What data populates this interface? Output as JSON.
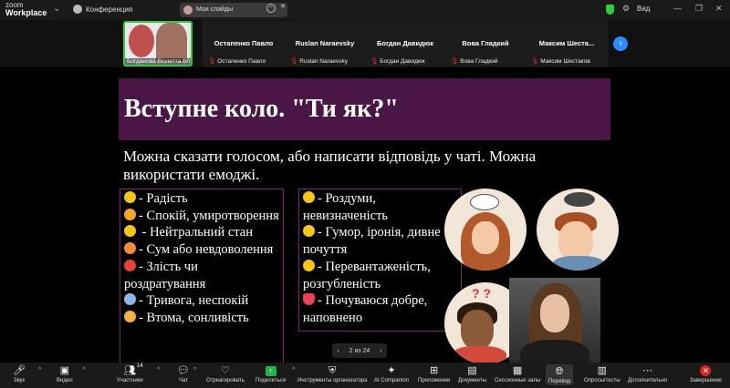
{
  "app": {
    "logo_line1": "zoom",
    "logo_line2": "Workplace"
  },
  "topbar": {
    "meeting_label": "Конференция",
    "share_title": "Мои слайды",
    "view_label": "Вид"
  },
  "participants": [
    {
      "display": "",
      "label": "Богданова Віолетта Віталі...",
      "muted": false,
      "active": true
    },
    {
      "display": "Остапенко Павло",
      "label": "Остапенко Павло",
      "muted": true
    },
    {
      "display": "Ruslan Naraevsky",
      "label": "Ruslan Naraevsky",
      "muted": true
    },
    {
      "display": "Богдан Давидюк",
      "label": "Богдан Давидюк",
      "muted": true
    },
    {
      "display": "Вова Гладкий",
      "label": "Вова Гладкий",
      "muted": true
    },
    {
      "display": "Максим Шеста...",
      "label": "Максим Шестаков",
      "muted": true
    }
  ],
  "slide": {
    "title": "Вступне коло. \"Ти як?\"",
    "subtitle": "Можна сказати голосом, або написати відповідь у чаті. Можна використати емоджі.",
    "left_items": [
      {
        "text": "- Радість",
        "emoji_color": "#f5c518"
      },
      {
        "text": "- Спокій, умиротворення",
        "emoji_color": "#f5a623"
      },
      {
        "text": " - Нейтральний стан",
        "emoji_color": "#f5c518"
      },
      {
        "text": "- Сум або невдоволення",
        "emoji_color": "#f08c3a"
      },
      {
        "text": "- Злість чи роздратування",
        "emoji_color": "#e8413a"
      },
      {
        "text": "- Тривога, неспокій",
        "emoji_color": "#8fb7e8"
      },
      {
        "text": "- Втома, сонливість",
        "emoji_color": "#f5b041"
      }
    ],
    "right_items": [
      {
        "text": "- Роздуми, невизначеність",
        "emoji_color": "#f5c518"
      },
      {
        "text": "- Гумор, іронія, дивне почуття",
        "emoji_color": "#f5c518"
      },
      {
        "text": "- Перевантаженість, розгубленість",
        "emoji_color": "#f5c518"
      },
      {
        "text": "- Почуваюся добре, наповнено",
        "emoji_color": "#e8415a"
      }
    ]
  },
  "pager": {
    "text": "2 из 24"
  },
  "toolbar": {
    "items": [
      {
        "label": "Звук",
        "icon": "microphone-icon"
      },
      {
        "label": "Видео",
        "icon": "camera-icon"
      },
      {
        "label": "Участники",
        "icon": "participants-icon",
        "count": "14"
      },
      {
        "label": "Чат",
        "icon": "chat-icon"
      },
      {
        "label": "Отреагировать",
        "icon": "heart-icon"
      },
      {
        "label": "Поделиться",
        "icon": "share-icon"
      },
      {
        "label": "Инструменты организатора",
        "icon": "shield-icon"
      },
      {
        "label": "AI Companion",
        "icon": "sparkle-icon"
      },
      {
        "label": "Приложения",
        "icon": "apps-icon"
      },
      {
        "label": "Документы",
        "icon": "docs-icon"
      },
      {
        "label": "Сессионные залы",
        "icon": "grid-icon"
      },
      {
        "label": "Перевод",
        "icon": "globe-icon"
      },
      {
        "label": "Опросы/тесты",
        "icon": "chart-icon"
      },
      {
        "label": "Дополнительно",
        "icon": "more-icon"
      },
      {
        "label": "Завершение",
        "icon": "end-icon"
      }
    ]
  },
  "colors": {
    "accent": "#2d8cff",
    "active_border": "#2ecc40",
    "title_bar": "#4a1645",
    "box_border": "#7a2a6e",
    "end": "#e02020",
    "share": "#21b24b"
  }
}
